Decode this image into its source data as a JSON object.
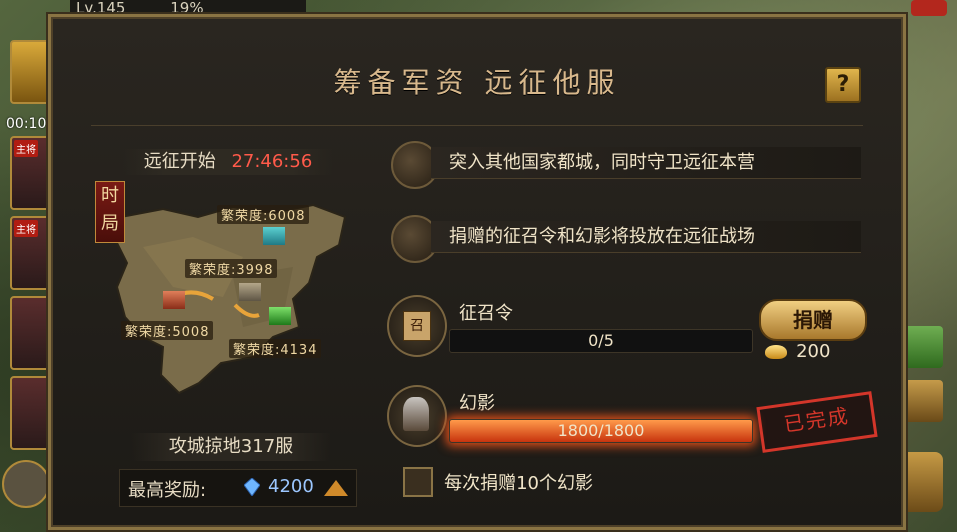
{
  "hud": {
    "level": "Lv.145",
    "exp_percent": "19%",
    "clock": "00:10",
    "side_tags": [
      "主将",
      "主将"
    ]
  },
  "dialog": {
    "title": "筹备军资 远征他服",
    "help_label": "?",
    "map": {
      "expedition_label": "远征开始",
      "countdown": "27:46:56",
      "season_badge": "时局",
      "prosperity": [
        "繁荣度:6008",
        "繁荣度:3998",
        "繁荣度:5008",
        "繁荣度:4134"
      ],
      "server_text": "攻城掠地317服",
      "reward_label": "最高奖励:",
      "reward_value": "4200"
    },
    "tasks": [
      {
        "text": "突入其他国家都城，同时守卫远征本营",
        "icon": "scroll-icon"
      },
      {
        "text": "捐赠的征召令和幻影将投放在远征战场",
        "icon": "scroll-icon"
      }
    ],
    "items": {
      "conscription": {
        "name": "征召令",
        "icon_glyph": "召",
        "progress_text": "0/5",
        "progress_ratio": 0,
        "donate_label": "捐赠",
        "gold_cost": "200"
      },
      "phantom": {
        "name": "幻影",
        "progress_text": "1800/1800",
        "progress_ratio": 1,
        "stamp_label": "已完成"
      }
    },
    "checkbox_label": "每次捐赠10个幻影"
  },
  "colors": {
    "accent_gold": "#d8b88c",
    "countdown_red": "#ff5a4a",
    "gem_blue": "#9cc7ff",
    "stamp_red": "#d3362a"
  }
}
